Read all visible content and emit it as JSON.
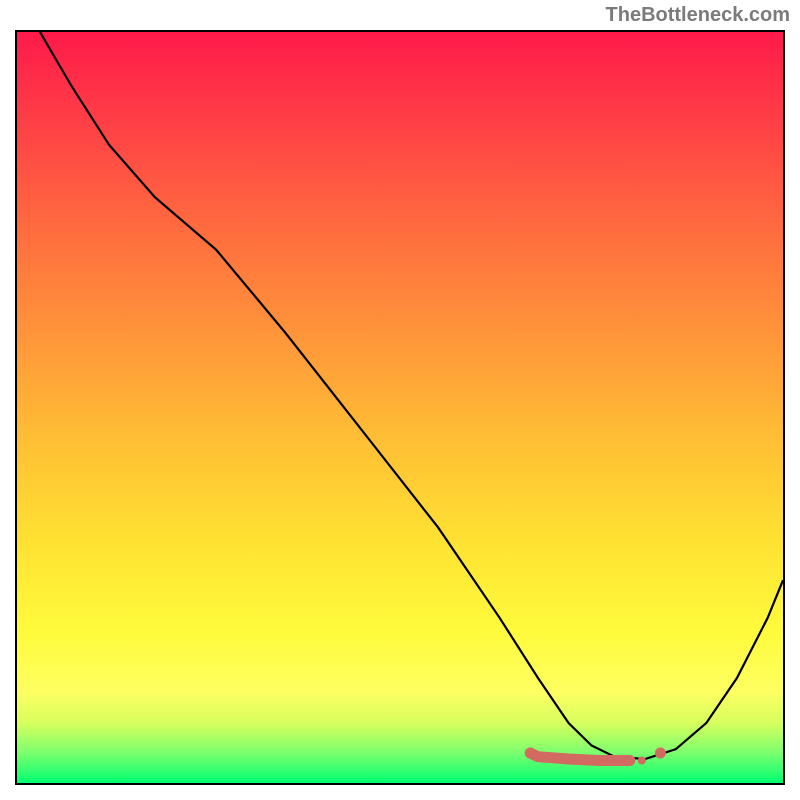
{
  "attribution": "TheBottleneck.com",
  "chart_data": {
    "type": "line",
    "title": "",
    "xlabel": "",
    "ylabel": "",
    "xlim": [
      0,
      100
    ],
    "ylim": [
      0,
      100
    ],
    "series": [
      {
        "name": "bottleneck-curve",
        "x": [
          3,
          7,
          12,
          18,
          26,
          35,
          45,
          55,
          63,
          68,
          72,
          75,
          78,
          82,
          86,
          90,
          94,
          98,
          100
        ],
        "y": [
          100,
          93,
          85,
          78,
          71,
          60,
          47,
          34,
          22,
          14,
          8,
          5,
          3.5,
          3.2,
          4.5,
          8,
          14,
          22,
          27
        ]
      }
    ],
    "markers": {
      "name": "highlight-points",
      "color": "#d26a62",
      "points": [
        {
          "x": 67,
          "y": 4.0
        },
        {
          "x": 68,
          "y": 3.5
        },
        {
          "x": 72,
          "y": 3.2
        },
        {
          "x": 74,
          "y": 3.1
        },
        {
          "x": 76,
          "y": 3.0
        },
        {
          "x": 77,
          "y": 3.0
        },
        {
          "x": 80,
          "y": 3.0
        },
        {
          "x": 84,
          "y": 4.0
        }
      ]
    },
    "background_gradient": {
      "top": "#ff1a4a",
      "middle": "#ffe232",
      "bottom": "#00ff71"
    }
  }
}
